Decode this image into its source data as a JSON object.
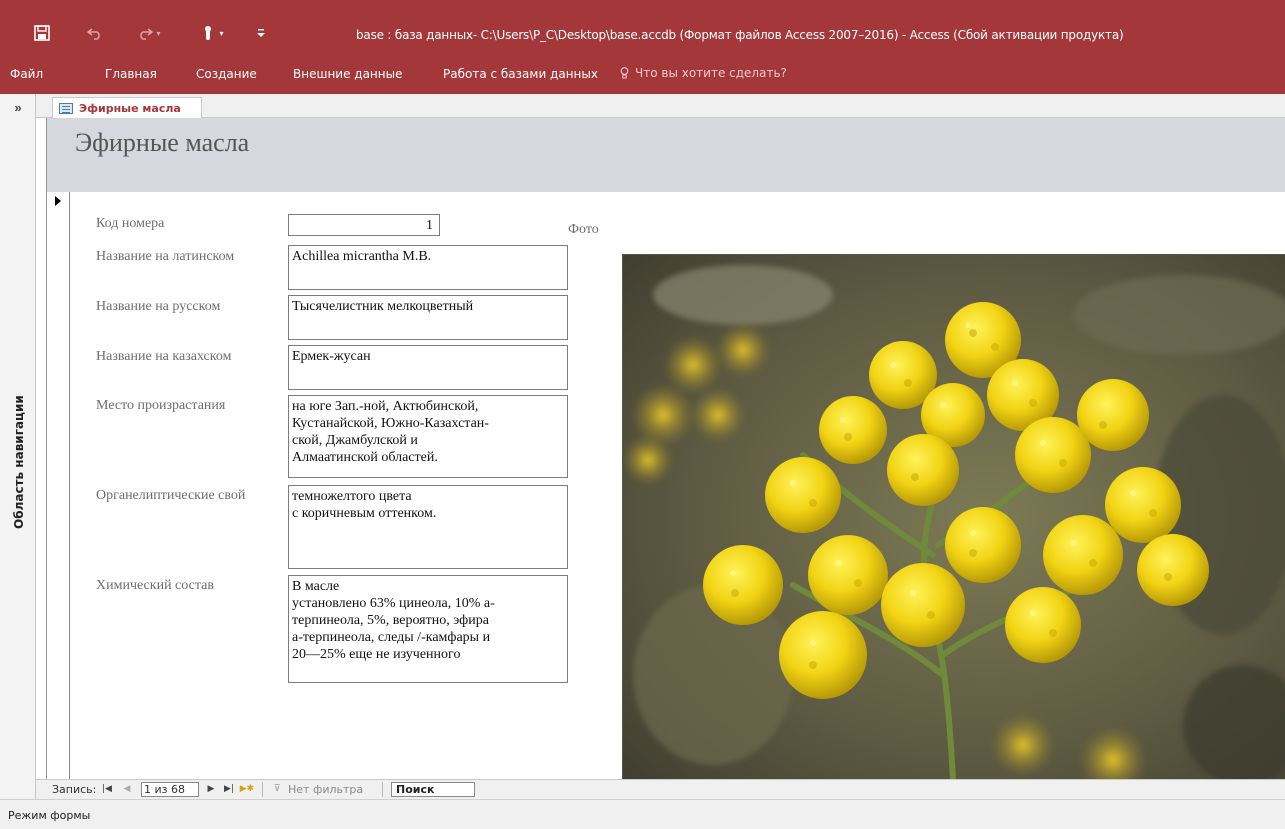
{
  "app": {
    "window_title": "base : база данных- C:\\Users\\P_C\\Desktop\\base.accdb (Формат файлов Access 2007–2016) - Access (Сбой активации продукта)",
    "accent_color": "#a4373a"
  },
  "quick_access": {
    "icons": [
      "save-icon",
      "undo-icon",
      "redo-icon",
      "touch-mode-icon",
      "customize-qat-icon"
    ]
  },
  "ribbon": {
    "tabs": [
      "Файл",
      "Главная",
      "Создание",
      "Внешние данные",
      "Работа с базами данных"
    ],
    "tell_me": "Что вы хотите сделать?"
  },
  "nav_pane": {
    "toggle": "»",
    "label": "Область навигации"
  },
  "document": {
    "tab_label": "Эфирные масла",
    "form_title": "Эфирные масла"
  },
  "form": {
    "fields": [
      {
        "label": "Код номера",
        "value": "1"
      },
      {
        "label": "Название на латинском",
        "value": "Achillea micrantha M.B."
      },
      {
        "label": "Название на русском",
        "value": "Тысячелистник мелкоцветный"
      },
      {
        "label": "Название на казахском",
        "value": "Ермек-жусан"
      },
      {
        "label": "Место произрастания",
        "value": " на юге Зап.-ной, Актюбинской,\nКустанайской, Южно-Казахстан-\nской, Джамбулской и\nАлмаатинской областей."
      },
      {
        "label": "Органелиптические свой",
        "value": "темножелтого цвета\nс коричневым оттенком."
      },
      {
        "label": "Химический состав",
        "value": "В масле\nустановлено 63% цинеола, 10% а-\nтерпинеола, 5%, вероятно, эфира\nа-терпинеола, следы /-камфары и\n20—25% еще не изученного"
      }
    ],
    "photo_label": "Фото"
  },
  "record_nav": {
    "label": "Запись:",
    "current": "1 из 68",
    "filter": "Нет фильтра",
    "search": "Поиск"
  },
  "status": {
    "mode": "Режим формы"
  }
}
